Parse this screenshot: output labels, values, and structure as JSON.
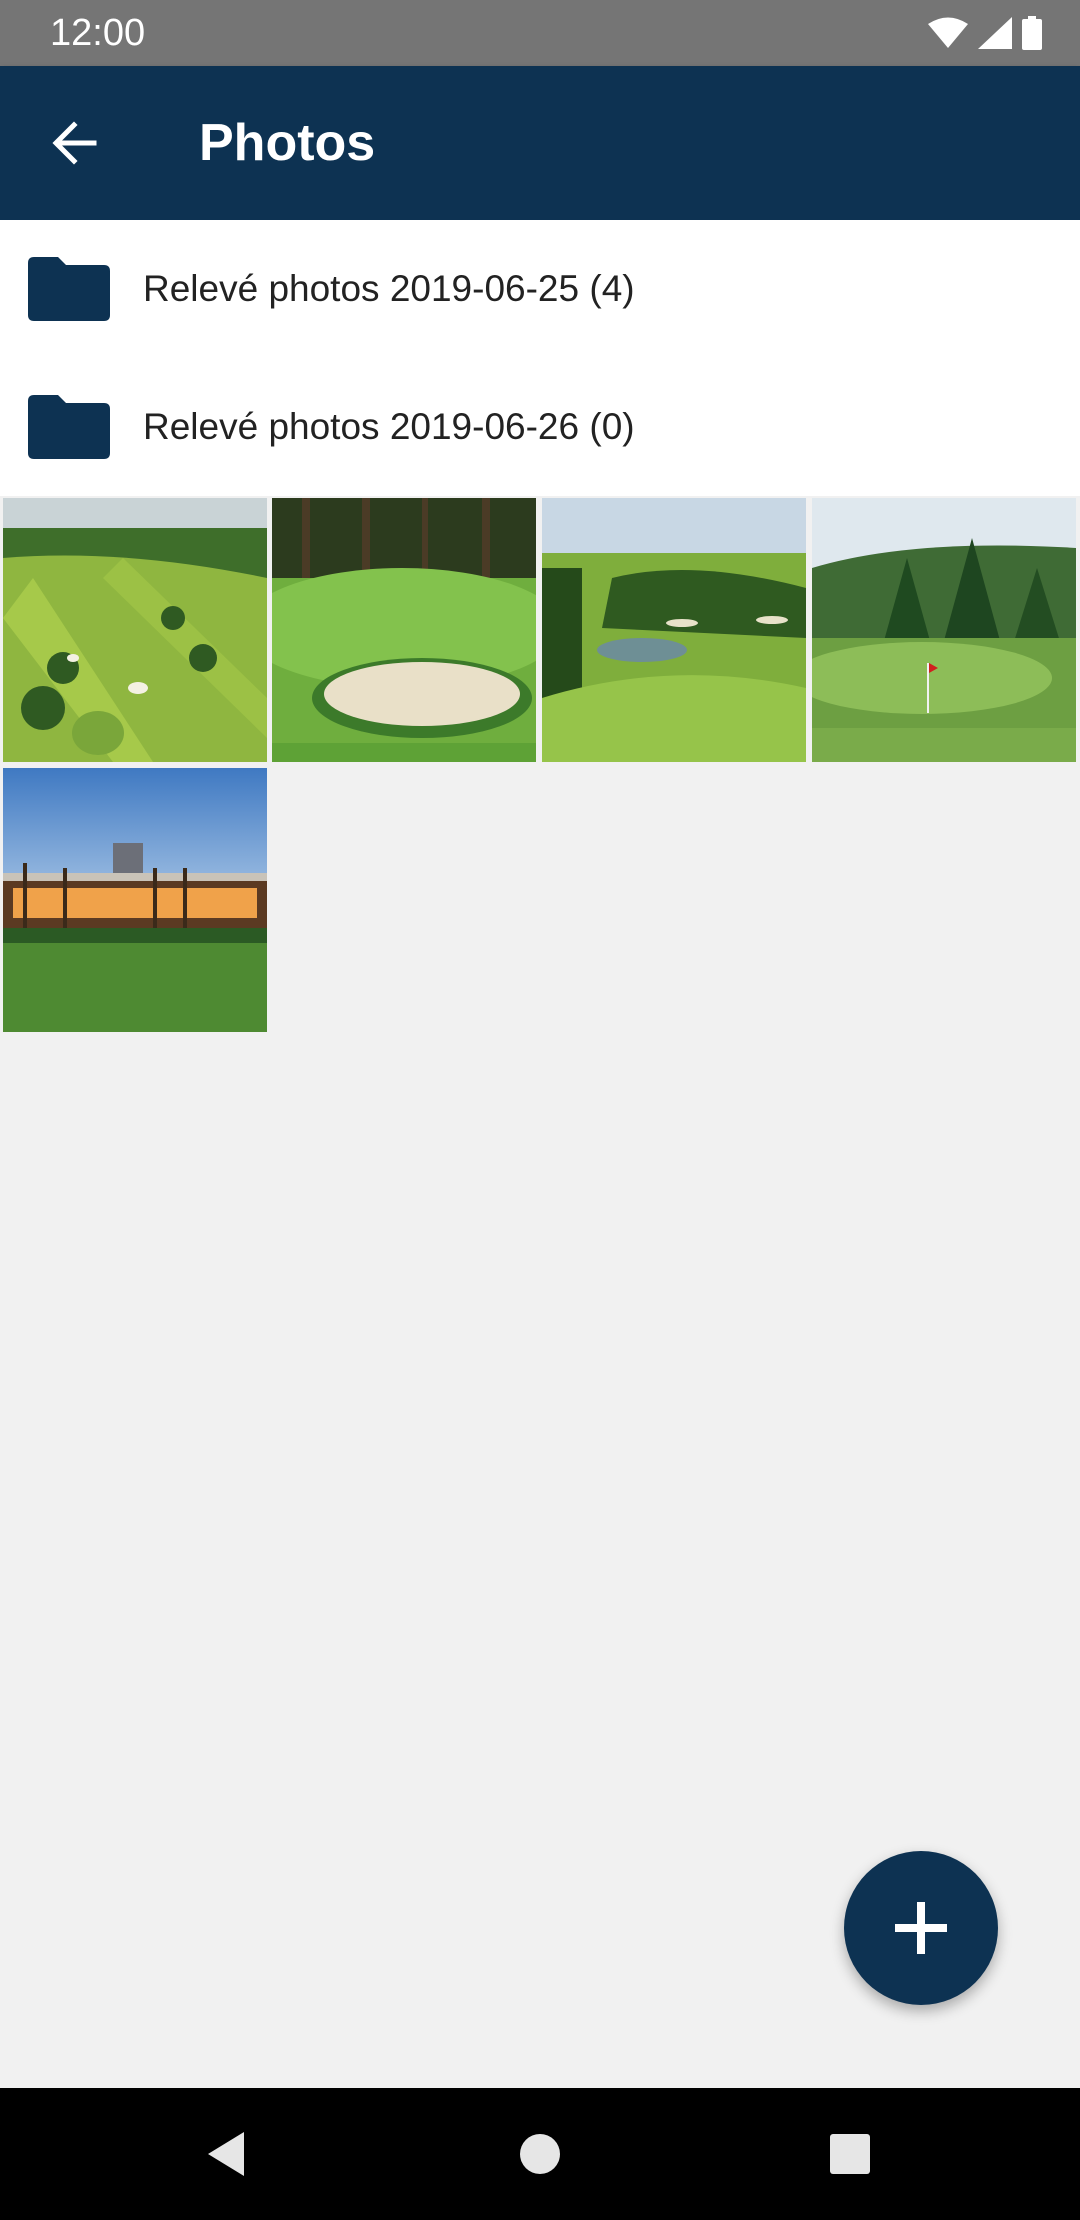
{
  "status_bar": {
    "time": "12:00",
    "icons": [
      "wifi-icon",
      "signal-icon",
      "battery-icon"
    ]
  },
  "app_bar": {
    "title": "Photos",
    "back_icon": "arrow-back-icon",
    "background": "#0d3252"
  },
  "folders": [
    {
      "label": "Relevé photos 2019-06-25 (4)",
      "icon": "folder-icon"
    },
    {
      "label": "Relevé photos 2019-06-26 (0)",
      "icon": "folder-icon"
    }
  ],
  "photos": [
    {
      "subject": "aerial golf course fairways"
    },
    {
      "subject": "golf green with sand bunker"
    },
    {
      "subject": "golf fairway with pond and trees"
    },
    {
      "subject": "golf green with red flag and pine trees"
    },
    {
      "subject": "golf clubhouse with palm trees at dusk"
    }
  ],
  "fab": {
    "icon": "plus-icon",
    "background": "#0d3252"
  },
  "nav_bar": {
    "icons": [
      "back-triangle-icon",
      "home-circle-icon",
      "recents-square-icon"
    ]
  },
  "colors": {
    "primary": "#0d3252",
    "status_bar": "#757575",
    "content_bg": "#f1f1f1"
  }
}
